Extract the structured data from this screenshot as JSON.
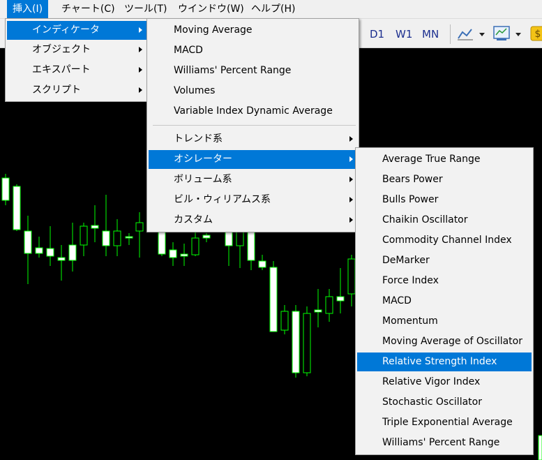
{
  "menubar": {
    "items": [
      "挿入(I)",
      "チャート(C)",
      "ツール(T)",
      "ウインドウ(W)",
      "ヘルプ(H)"
    ]
  },
  "toolbar": {
    "timeframes": [
      "D1",
      "W1",
      "MN"
    ],
    "icons": [
      "line-chart-icon",
      "chart-template-icon",
      "dollar-icon"
    ]
  },
  "insert_menu": {
    "items": [
      {
        "label": "インディケータ",
        "submenu": true
      },
      {
        "label": "オブジェクト",
        "submenu": true
      },
      {
        "label": "エキスパート",
        "submenu": true
      },
      {
        "label": "スクリプト",
        "submenu": true
      }
    ]
  },
  "indicators_menu": {
    "items": [
      "Moving Average",
      "MACD",
      "Williams' Percent Range",
      "Volumes",
      "Variable Index Dynamic Average"
    ],
    "groups": [
      {
        "label": "トレンド系"
      },
      {
        "label": "オシレーター"
      },
      {
        "label": "ボリューム系"
      },
      {
        "label": "ビル・ウィリアムス系"
      },
      {
        "label": "カスタム"
      }
    ]
  },
  "oscillators_menu": {
    "items": [
      "Average True Range",
      "Bears Power",
      "Bulls Power",
      "Chaikin Oscillator",
      "Commodity Channel Index",
      "DeMarker",
      "Force Index",
      "MACD",
      "Momentum",
      "Moving Average of Oscillator",
      "Relative Strength Index",
      "Relative Vigor Index",
      "Stochastic Oscillator",
      "Triple Exponential Average",
      "Williams' Percent Range"
    ],
    "highlighted": "Relative Strength Index"
  },
  "colors": {
    "highlight": "#0078d7",
    "candle_up": "#ffffff",
    "candle_wick": "#00ff00",
    "background": "#000000"
  }
}
